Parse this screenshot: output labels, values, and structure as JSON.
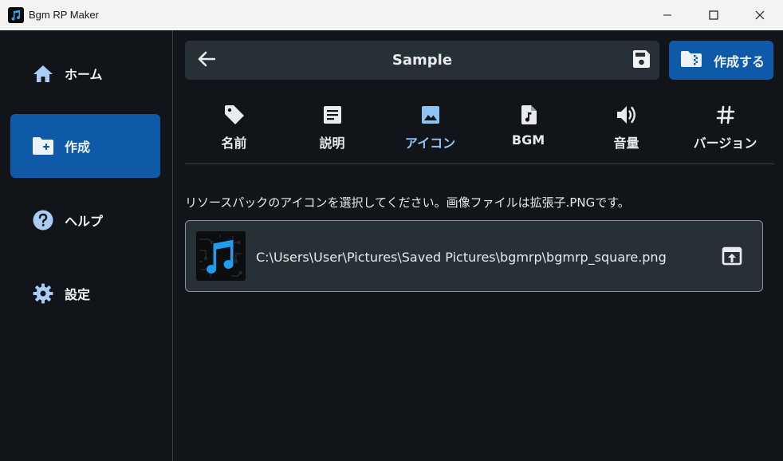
{
  "window": {
    "title": "Bgm RP Maker",
    "controls": [
      "minimize-icon",
      "maximize-icon",
      "close-icon"
    ]
  },
  "sidebar": {
    "items": [
      {
        "label": "ホーム",
        "icon": "home-icon",
        "active": false
      },
      {
        "label": "作成",
        "icon": "folder-add-icon",
        "active": true
      },
      {
        "label": "ヘルプ",
        "icon": "help-icon",
        "active": false
      },
      {
        "label": "設定",
        "icon": "gear-icon",
        "active": false
      }
    ]
  },
  "header": {
    "title": "Sample",
    "back_icon": "arrow-back-icon",
    "save_icon": "save-icon"
  },
  "create_button": {
    "label": "作成する",
    "icon": "folder-zip-icon"
  },
  "tabs": [
    {
      "label": "名前",
      "icon": "tag-icon",
      "active": false
    },
    {
      "label": "説明",
      "icon": "article-icon",
      "active": false
    },
    {
      "label": "アイコン",
      "icon": "image-icon",
      "active": true
    },
    {
      "label": "BGM",
      "icon": "audio-file-icon",
      "active": false
    },
    {
      "label": "音量",
      "icon": "volume-icon",
      "active": false
    },
    {
      "label": "バージョン",
      "icon": "hash-icon",
      "active": false
    }
  ],
  "icon_section": {
    "description": "リソースパックのアイコンを選択してください。画像ファイルは拡張子.PNGです。",
    "file_path": "C:\\Users\\User\\Pictures\\Saved Pictures\\bgmrp\\bgmrp_square.png",
    "open_icon": "file-open-icon"
  },
  "colors": {
    "background": "#111418",
    "accent": "#0f5aa8",
    "active_tab": "#8fc3f3",
    "panel": "#283037"
  }
}
